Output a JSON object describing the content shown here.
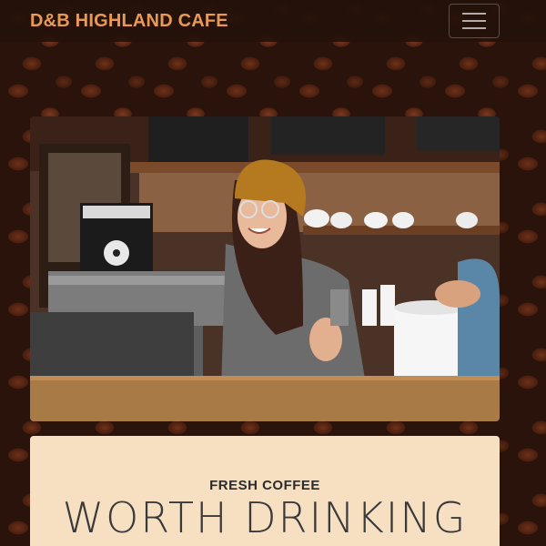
{
  "navbar": {
    "brand": "D&B HIGHLAND CAFE",
    "toggle_icon": "hamburger-menu-icon"
  },
  "hero": {
    "image": "barista-smiling-at-espresso-machine"
  },
  "intro": {
    "subheading": "FRESH COFFEE",
    "heading": "WORTH DRINKING"
  },
  "colors": {
    "brand": "#e89a54",
    "card_bg": "#f7dfc2",
    "navbar_bg": "#24110a"
  }
}
